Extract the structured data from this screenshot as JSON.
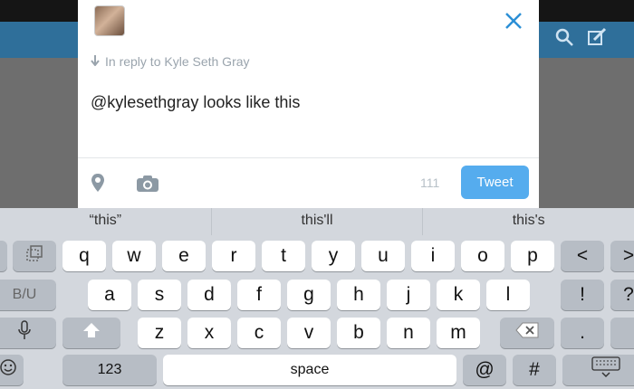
{
  "compose": {
    "reply_label": "In reply to Kyle Seth Gray",
    "tweet_text": "@kylesethgray looks like this",
    "char_count": "111",
    "tweet_button": "Tweet"
  },
  "keyboard": {
    "predictions": [
      "“this”",
      "this'll",
      "this's"
    ],
    "row1": [
      "q",
      "w",
      "e",
      "r",
      "t",
      "y",
      "u",
      "i",
      "o",
      "p"
    ],
    "row2": [
      "a",
      "s",
      "d",
      "f",
      "g",
      "h",
      "j",
      "k",
      "l"
    ],
    "row3": [
      "z",
      "x",
      "c",
      "v",
      "b",
      "n",
      "m"
    ],
    "numbers_key": "123",
    "space_key": "space",
    "at_key": "@",
    "hash_key": "#",
    "exclaim_key": "!",
    "question_key": "?",
    "period_key": ".",
    "left_bracket": "<",
    "right_bracket": ">",
    "format_key": "B/U"
  }
}
